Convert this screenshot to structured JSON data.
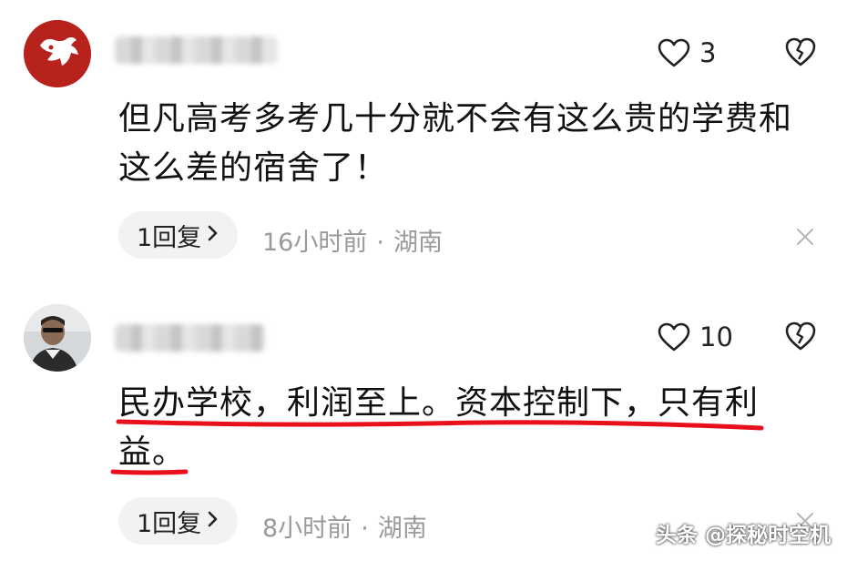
{
  "comments": [
    {
      "text": "但凡高考多考几十分就不会有这么贵的学费和这么差的宿舍了！",
      "likes": "3",
      "reply_label": "1回复",
      "time": "16小时前",
      "location": "湖南",
      "separator": "·"
    },
    {
      "text": "民办学校，利润至上。资本控制下，只有利益。",
      "likes": "10",
      "reply_label": "1回复",
      "time": "8小时前",
      "location": "湖南",
      "separator": "·"
    }
  ],
  "icons": {
    "like": "heart-outline-icon",
    "dislike": "broken-heart-icon",
    "close": "close-x-icon",
    "reply_chevron": "chevron-right-icon"
  },
  "colors": {
    "underline": "#e8101a",
    "meta_text": "#9a9a9a",
    "reply_bg": "#f2f2f2"
  },
  "watermark": "头条 @探秘时空机"
}
